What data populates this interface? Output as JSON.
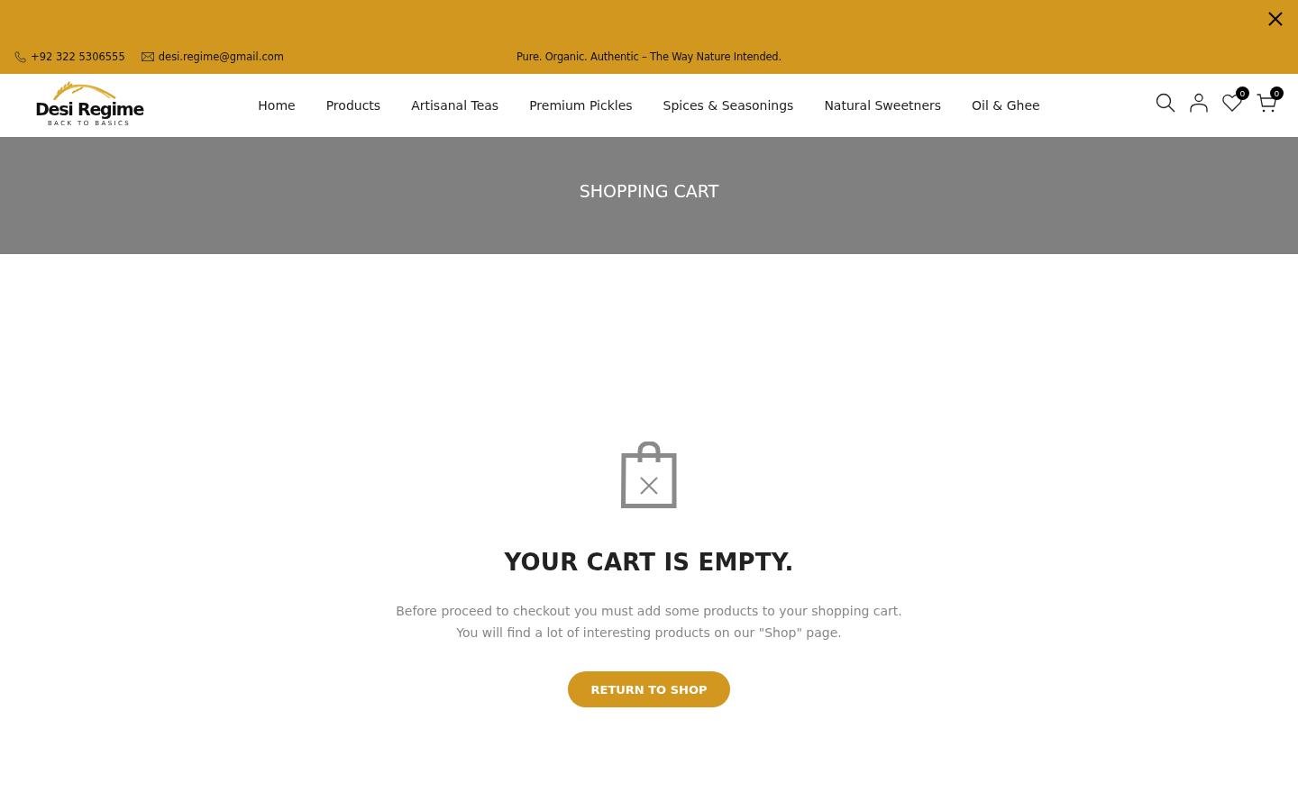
{
  "top_bar": {
    "phone": "+92 322 5306555",
    "email": "desi.regime@gmail.com",
    "tagline": "Pure. Organic. Authentic – The Way Nature Intended."
  },
  "header": {
    "logo": {
      "name": "Desi Regime",
      "tagline": "BACK TO BASICS"
    },
    "nav": [
      "Home",
      "Products",
      "Artisanal Teas",
      "Premium Pickles",
      "Spices & Seasonings",
      "Natural Sweetners",
      "Oil & Ghee"
    ],
    "wishlist_count": "0",
    "cart_count": "0"
  },
  "page_title": "SHOPPING CART",
  "empty_cart": {
    "heading": "YOUR CART IS EMPTY.",
    "lines": [
      "Before proceed to checkout you must add some products to your shopping cart.",
      "You will find a lot of interesting products on our \"Shop\" page."
    ],
    "button": "RETURN TO SHOP"
  }
}
